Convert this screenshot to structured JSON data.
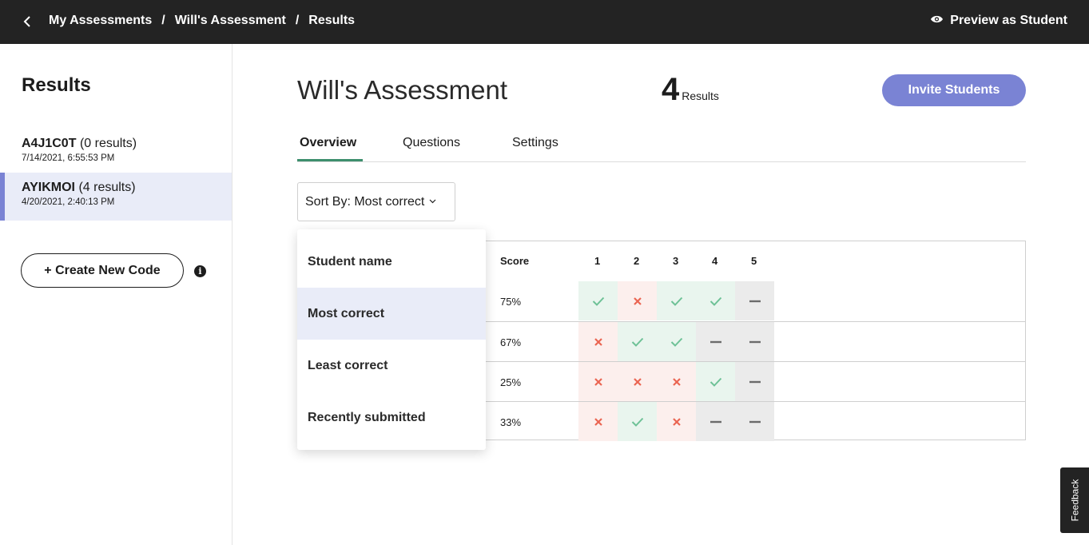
{
  "topbar": {
    "breadcrumb": [
      "My Assessments",
      "Will's Assessment",
      "Results"
    ],
    "separator": "/",
    "back_icon": "chevron-left-icon",
    "preview_label": "Preview as Student",
    "preview_icon": "eye-icon"
  },
  "sidebar": {
    "title": "Results",
    "codes": [
      {
        "code": "A4J1C0T",
        "count": "(0 results)",
        "date": "7/14/2021, 6:55:53 PM"
      },
      {
        "code": "AYIKMOI",
        "count": "(4 results)",
        "date": "4/20/2021, 2:40:13 PM"
      }
    ],
    "create_label": "+ Create New Code",
    "info_icon": "info-icon"
  },
  "main": {
    "title": "Will's Assessment",
    "result_count": "4",
    "result_label": "Results",
    "invite_label": "Invite Students",
    "tabs": [
      {
        "label": "Overview"
      },
      {
        "label": "Questions"
      },
      {
        "label": "Settings"
      }
    ],
    "sort_label": "Sort By: Most correct",
    "sort_caret": "⌄"
  },
  "table": {
    "score_header": "Score",
    "question_headers": [
      "1",
      "2",
      "3",
      "4",
      "5"
    ],
    "rows": [
      {
        "score": "75%",
        "answers": [
          "correct",
          "wrong",
          "correct",
          "correct",
          "none"
        ]
      },
      {
        "score": "67%",
        "answers": [
          "wrong",
          "correct",
          "correct",
          "none",
          "none"
        ]
      },
      {
        "score": "25%",
        "answers": [
          "wrong",
          "wrong",
          "wrong",
          "correct",
          "none"
        ]
      },
      {
        "score": "33%",
        "answers": [
          "wrong",
          "correct",
          "wrong",
          "none",
          "none"
        ]
      }
    ]
  },
  "dropdown": {
    "options": [
      "Student name",
      "Most correct",
      "Least correct",
      "Recently submitted"
    ],
    "selected": "Most correct"
  },
  "feedback_label": "Feedback",
  "colors": {
    "topbar": "#232323",
    "accent": "#7a83d4",
    "tab_underline": "#3d8f6d",
    "correct": "#6dc196",
    "wrong": "#ea6552",
    "none": "#6b6b6b"
  }
}
